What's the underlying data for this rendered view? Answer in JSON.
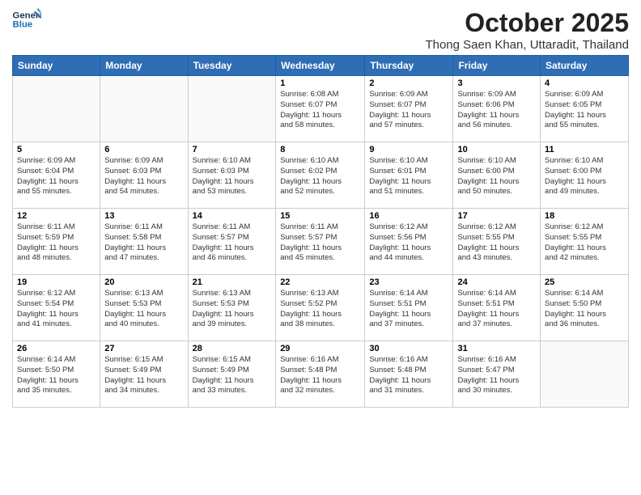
{
  "logo": {
    "line1": "General",
    "line2": "Blue"
  },
  "title": "October 2025",
  "subtitle": "Thong Saen Khan, Uttaradit, Thailand",
  "days_of_week": [
    "Sunday",
    "Monday",
    "Tuesday",
    "Wednesday",
    "Thursday",
    "Friday",
    "Saturday"
  ],
  "weeks": [
    [
      {
        "day": "",
        "info": ""
      },
      {
        "day": "",
        "info": ""
      },
      {
        "day": "",
        "info": ""
      },
      {
        "day": "1",
        "info": "Sunrise: 6:08 AM\nSunset: 6:07 PM\nDaylight: 11 hours\nand 58 minutes."
      },
      {
        "day": "2",
        "info": "Sunrise: 6:09 AM\nSunset: 6:07 PM\nDaylight: 11 hours\nand 57 minutes."
      },
      {
        "day": "3",
        "info": "Sunrise: 6:09 AM\nSunset: 6:06 PM\nDaylight: 11 hours\nand 56 minutes."
      },
      {
        "day": "4",
        "info": "Sunrise: 6:09 AM\nSunset: 6:05 PM\nDaylight: 11 hours\nand 55 minutes."
      }
    ],
    [
      {
        "day": "5",
        "info": "Sunrise: 6:09 AM\nSunset: 6:04 PM\nDaylight: 11 hours\nand 55 minutes."
      },
      {
        "day": "6",
        "info": "Sunrise: 6:09 AM\nSunset: 6:03 PM\nDaylight: 11 hours\nand 54 minutes."
      },
      {
        "day": "7",
        "info": "Sunrise: 6:10 AM\nSunset: 6:03 PM\nDaylight: 11 hours\nand 53 minutes."
      },
      {
        "day": "8",
        "info": "Sunrise: 6:10 AM\nSunset: 6:02 PM\nDaylight: 11 hours\nand 52 minutes."
      },
      {
        "day": "9",
        "info": "Sunrise: 6:10 AM\nSunset: 6:01 PM\nDaylight: 11 hours\nand 51 minutes."
      },
      {
        "day": "10",
        "info": "Sunrise: 6:10 AM\nSunset: 6:00 PM\nDaylight: 11 hours\nand 50 minutes."
      },
      {
        "day": "11",
        "info": "Sunrise: 6:10 AM\nSunset: 6:00 PM\nDaylight: 11 hours\nand 49 minutes."
      }
    ],
    [
      {
        "day": "12",
        "info": "Sunrise: 6:11 AM\nSunset: 5:59 PM\nDaylight: 11 hours\nand 48 minutes."
      },
      {
        "day": "13",
        "info": "Sunrise: 6:11 AM\nSunset: 5:58 PM\nDaylight: 11 hours\nand 47 minutes."
      },
      {
        "day": "14",
        "info": "Sunrise: 6:11 AM\nSunset: 5:57 PM\nDaylight: 11 hours\nand 46 minutes."
      },
      {
        "day": "15",
        "info": "Sunrise: 6:11 AM\nSunset: 5:57 PM\nDaylight: 11 hours\nand 45 minutes."
      },
      {
        "day": "16",
        "info": "Sunrise: 6:12 AM\nSunset: 5:56 PM\nDaylight: 11 hours\nand 44 minutes."
      },
      {
        "day": "17",
        "info": "Sunrise: 6:12 AM\nSunset: 5:55 PM\nDaylight: 11 hours\nand 43 minutes."
      },
      {
        "day": "18",
        "info": "Sunrise: 6:12 AM\nSunset: 5:55 PM\nDaylight: 11 hours\nand 42 minutes."
      }
    ],
    [
      {
        "day": "19",
        "info": "Sunrise: 6:12 AM\nSunset: 5:54 PM\nDaylight: 11 hours\nand 41 minutes."
      },
      {
        "day": "20",
        "info": "Sunrise: 6:13 AM\nSunset: 5:53 PM\nDaylight: 11 hours\nand 40 minutes."
      },
      {
        "day": "21",
        "info": "Sunrise: 6:13 AM\nSunset: 5:53 PM\nDaylight: 11 hours\nand 39 minutes."
      },
      {
        "day": "22",
        "info": "Sunrise: 6:13 AM\nSunset: 5:52 PM\nDaylight: 11 hours\nand 38 minutes."
      },
      {
        "day": "23",
        "info": "Sunrise: 6:14 AM\nSunset: 5:51 PM\nDaylight: 11 hours\nand 37 minutes."
      },
      {
        "day": "24",
        "info": "Sunrise: 6:14 AM\nSunset: 5:51 PM\nDaylight: 11 hours\nand 37 minutes."
      },
      {
        "day": "25",
        "info": "Sunrise: 6:14 AM\nSunset: 5:50 PM\nDaylight: 11 hours\nand 36 minutes."
      }
    ],
    [
      {
        "day": "26",
        "info": "Sunrise: 6:14 AM\nSunset: 5:50 PM\nDaylight: 11 hours\nand 35 minutes."
      },
      {
        "day": "27",
        "info": "Sunrise: 6:15 AM\nSunset: 5:49 PM\nDaylight: 11 hours\nand 34 minutes."
      },
      {
        "day": "28",
        "info": "Sunrise: 6:15 AM\nSunset: 5:49 PM\nDaylight: 11 hours\nand 33 minutes."
      },
      {
        "day": "29",
        "info": "Sunrise: 6:16 AM\nSunset: 5:48 PM\nDaylight: 11 hours\nand 32 minutes."
      },
      {
        "day": "30",
        "info": "Sunrise: 6:16 AM\nSunset: 5:48 PM\nDaylight: 11 hours\nand 31 minutes."
      },
      {
        "day": "31",
        "info": "Sunrise: 6:16 AM\nSunset: 5:47 PM\nDaylight: 11 hours\nand 30 minutes."
      },
      {
        "day": "",
        "info": ""
      }
    ]
  ]
}
